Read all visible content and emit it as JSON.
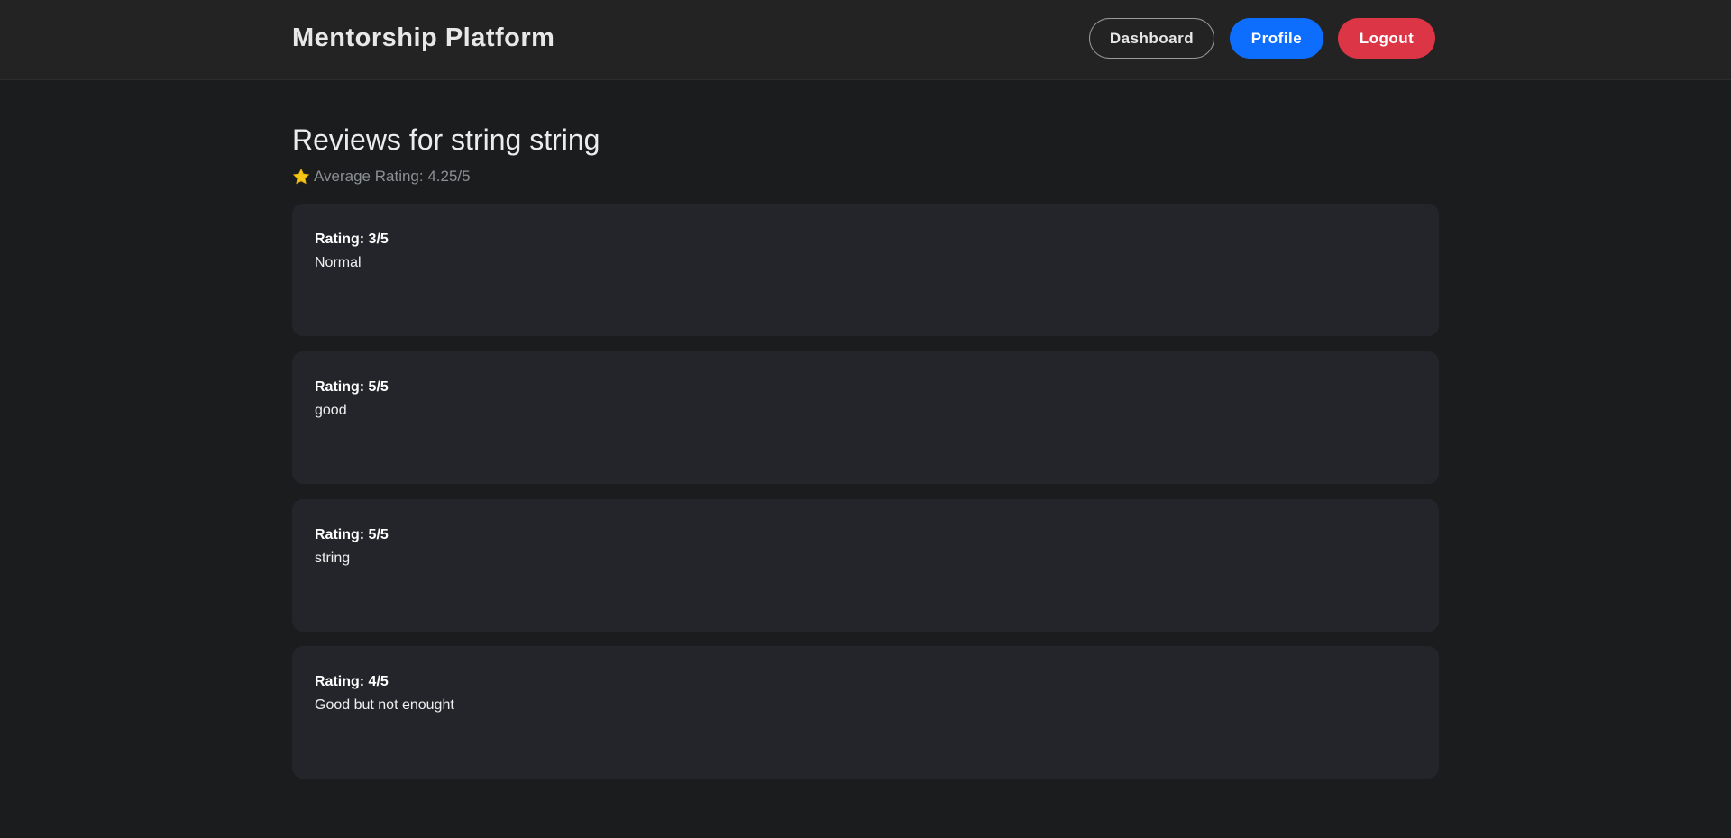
{
  "header": {
    "brand": "Mentorship Platform",
    "nav": {
      "dashboard": "Dashboard",
      "profile": "Profile",
      "logout": "Logout"
    }
  },
  "main": {
    "title": "Reviews for string string",
    "average_rating_text": "Average Rating: 4.25/5",
    "average_rating_icon": "star-icon",
    "reviews": [
      {
        "rating_label": "Rating: 3/5",
        "comment": "Normal"
      },
      {
        "rating_label": "Rating: 5/5",
        "comment": "good"
      },
      {
        "rating_label": "Rating: 5/5",
        "comment": "string"
      },
      {
        "rating_label": "Rating: 4/5",
        "comment": "Good but not enought"
      }
    ]
  },
  "colors": {
    "background": "#1b1c1e",
    "header": "#232323",
    "card": "#23252a",
    "profile_button": "#0d6efd",
    "logout_button": "#dc3545",
    "star": "#f5c518"
  }
}
